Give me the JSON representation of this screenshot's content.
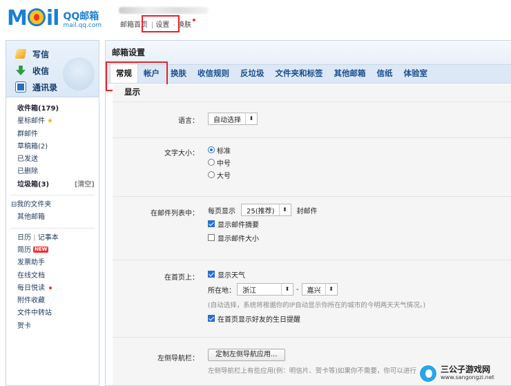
{
  "header": {
    "logo_text": "M",
    "logo_text_tail": "il",
    "logo_cn": "QQ邮箱",
    "logo_domain": "mail.qq.com",
    "links": [
      "邮箱首页",
      "设置",
      "换肤"
    ]
  },
  "sidebar": {
    "compose": [
      {
        "label": "写信",
        "icon": "write-icon"
      },
      {
        "label": "收信",
        "icon": "receive-icon"
      },
      {
        "label": "通讯录",
        "icon": "contacts-icon"
      }
    ],
    "folders": [
      {
        "label": "收件箱(179)",
        "bold": true
      },
      {
        "label": "星标邮件",
        "star": true
      },
      {
        "label": "群邮件"
      },
      {
        "label": "草稿箱(2)"
      },
      {
        "label": "已发送"
      },
      {
        "label": "已删除"
      },
      {
        "label": "垃圾箱(3)",
        "bold": true,
        "action": "[清空]"
      }
    ],
    "my_folders": [
      "⊟我的文件夹",
      "其他邮箱"
    ],
    "apps": {
      "calendar": "日历",
      "notebook": "记事本",
      "resume": "简历",
      "resume_badge": "NEW",
      "items": [
        "发票助手",
        "在线文档",
        "每日悦读",
        "附件收藏",
        "文件中转站",
        "贺卡"
      ]
    }
  },
  "main": {
    "title": "邮箱设置",
    "tabs": [
      "常规",
      "帐户",
      "换肤",
      "收信规则",
      "反垃圾",
      "文件夹和标签",
      "其他邮箱",
      "信纸",
      "体验室"
    ],
    "active_tab": 0,
    "section_title": "显示",
    "language": {
      "label": "语言：",
      "value": "自动选择"
    },
    "font_size": {
      "label": "文字大小：",
      "options": [
        "标准",
        "中号",
        "大号"
      ],
      "selected": 0
    },
    "mail_list": {
      "label": "在邮件列表中：",
      "per_page_prefix": "每页显示",
      "per_page_value": "25(推荐)",
      "per_page_suffix": "封邮件",
      "show_summary": "显示邮件摘要",
      "show_summary_checked": true,
      "show_size": "显示邮件大小",
      "show_size_checked": false
    },
    "home_page": {
      "label": "在首页上：",
      "show_weather": "显示天气",
      "show_weather_checked": true,
      "location_label": "所在地：",
      "province": "浙江",
      "dash": "-",
      "city": "嘉兴",
      "hint": "(自动选择，系统将根据你的IP自动显示你所在的城市的今明两天天气情况。)",
      "birthday": "在首页显示好友的生日提醒",
      "birthday_checked": true
    },
    "nav": {
      "label": "左侧导航栏：",
      "button": "定制左侧导航应用...",
      "hint": "左侧导航栏上有些应用(例：明信片、贺卡等)如果你不需要，你可以进行"
    }
  },
  "watermark": {
    "name": "三公子游戏网",
    "url": "www.sangongzi.net"
  },
  "colors": {
    "brand": "#1c7fd0",
    "highlight": "#e8202a",
    "tab_bg": "#dce8f5",
    "link": "#1a4d8f"
  }
}
